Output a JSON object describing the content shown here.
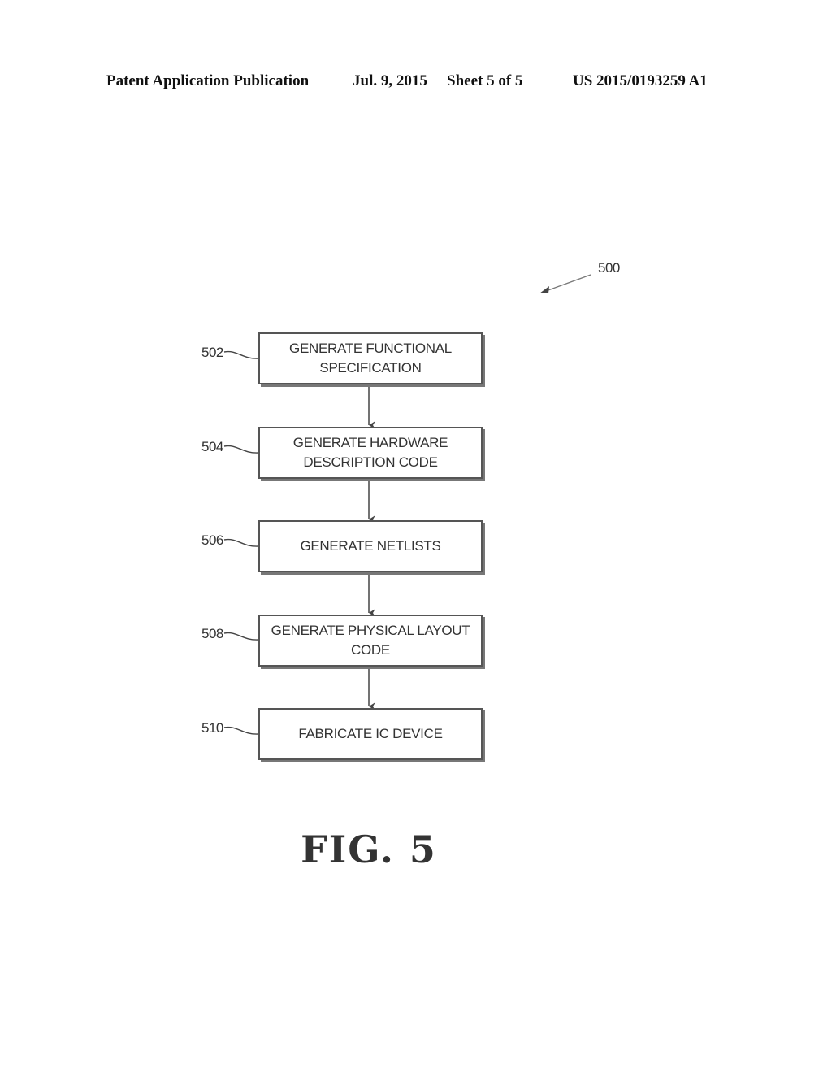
{
  "header": {
    "publication": "Patent Application Publication",
    "date": "Jul. 9, 2015",
    "sheet": "Sheet 5 of 5",
    "number": "US 2015/0193259 A1"
  },
  "figure": {
    "ref": "500",
    "caption": "FIG. 5",
    "steps": [
      {
        "ref": "502",
        "line1": "GENERATE FUNCTIONAL",
        "line2": "SPECIFICATION"
      },
      {
        "ref": "504",
        "line1": "GENERATE HARDWARE",
        "line2": "DESCRIPTION CODE"
      },
      {
        "ref": "506",
        "line1": "GENERATE NETLISTS",
        "line2": ""
      },
      {
        "ref": "508",
        "line1": "GENERATE PHYSICAL LAYOUT",
        "line2": "CODE"
      },
      {
        "ref": "510",
        "line1": "FABRICATE IC DEVICE",
        "line2": ""
      }
    ]
  }
}
